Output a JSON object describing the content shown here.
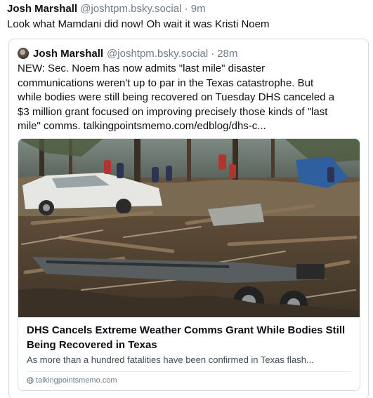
{
  "post": {
    "author_name": "Josh Marshall",
    "author_handle": "@joshtpm.bsky.social",
    "separator": "·",
    "time": "9m",
    "text": "Look what Mamdani did now! Oh wait it was Kristi Noem"
  },
  "quote": {
    "author_name": "Josh Marshall",
    "author_handle": "@joshtpm.bsky.social",
    "separator": "·",
    "time": "28m",
    "text_lines": [
      "NEW: Sec. Noem has now admits \"last mile\" disaster",
      "communications weren't up to par in the Texas catastrophe. But",
      "while bodies were still being recovered on Tuesday DHS canceled a",
      "$3 million grant focused on improving precisely those kinds of \"last",
      "mile\" comms. talkingpointsmemo.com/edblog/dhs-c..."
    ],
    "avatar_icon": "avatar"
  },
  "link_card": {
    "image_description_icon": "flood-debris-photo",
    "title_lines": [
      "DHS Cancels Extreme Weather Comms Grant While Bodies Still",
      "Being Recovered in Texas"
    ],
    "description": "As more than a hundred fatalities have been confirmed in Texas flash...",
    "domain": "talkingpointsmemo.com",
    "domain_icon": "globe-icon"
  },
  "colors": {
    "text": "#0b0f14",
    "muted": "#6f7d8c",
    "border": "#d4dbe2"
  }
}
